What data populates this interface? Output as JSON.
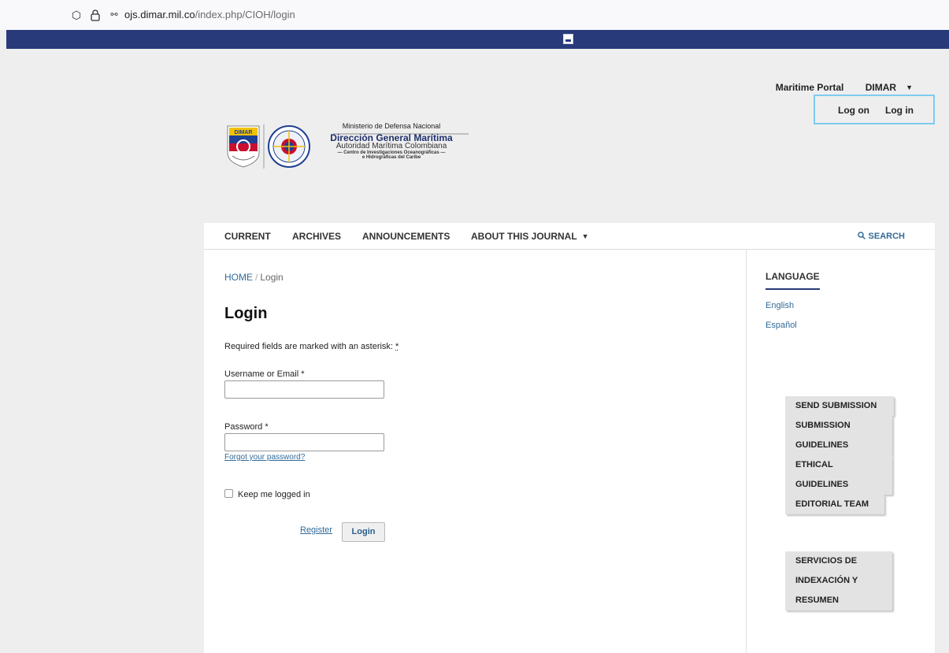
{
  "browser": {
    "url_domain": "ojs.dimar.mil.co",
    "url_path": "/index.php/CIOH/login"
  },
  "header": {
    "user_nav": [
      "Maritime Portal",
      "DIMAR"
    ],
    "login_links": [
      "Log on",
      "Log in"
    ],
    "logo": {
      "line1": "Ministerio de Defensa Nacional",
      "line2": "Dirección General Marítima",
      "line3": "Autoridad Marítima Colombiana",
      "line4": "— Centro de Investigaciones Oceanográficas —",
      "line5": "e Hidrográficas del Caribe",
      "badge_text": "DIMAR"
    }
  },
  "nav": {
    "items": [
      "CURRENT",
      "ARCHIVES",
      "ANNOUNCEMENTS",
      "ABOUT THIS JOURNAL"
    ],
    "search": "SEARCH"
  },
  "main": {
    "breadcrumb_home": "HOME",
    "breadcrumb_current": "Login",
    "title": "Login",
    "required_note": "Required fields are marked with an asterisk:",
    "required_mark": "*",
    "username_label": "Username or Email *",
    "password_label": "Password *",
    "forgot": "Forgot your password?",
    "keep_logged": "Keep me logged in",
    "register": "Register",
    "login_button": "Login"
  },
  "sidebar": {
    "language_heading": "LANGUAGE",
    "languages": [
      "English",
      "Español"
    ],
    "buttons": [
      [
        "SEND SUBMISSION"
      ],
      [
        "SUBMISSION",
        "GUIDELINES"
      ],
      [
        "ETHICAL",
        "GUIDELINES"
      ],
      [
        "EDITORIAL TEAM"
      ],
      [
        "SERVICIOS DE",
        "INDEXACIÓN Y",
        "RESUMEN"
      ]
    ]
  },
  "colors": {
    "banner": "#283a7a",
    "link": "#316b9a",
    "highlight": "#7fcbf0"
  }
}
